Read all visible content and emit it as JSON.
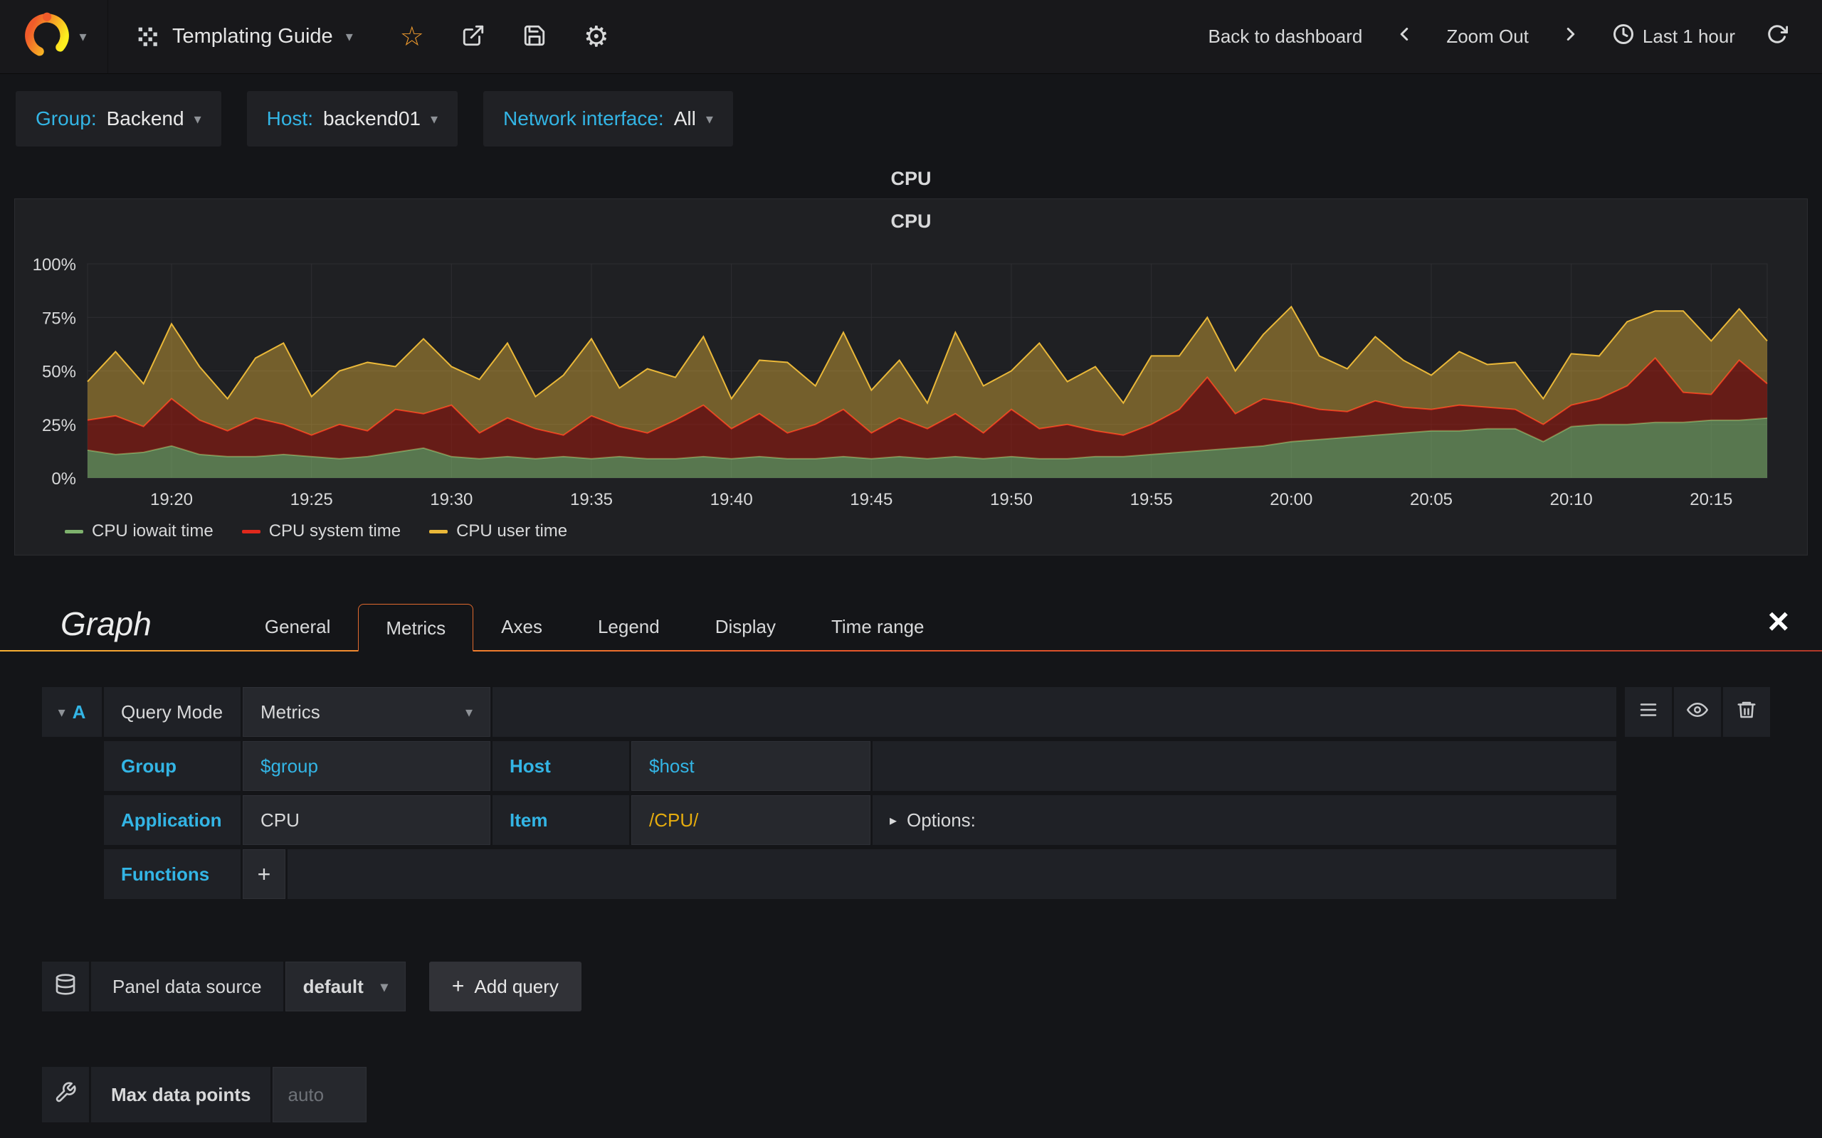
{
  "navbar": {
    "dashboard_title": "Templating Guide",
    "back_label": "Back to dashboard",
    "zoom_out_label": "Zoom Out",
    "time_label": "Last 1 hour"
  },
  "variables": [
    {
      "label": "Group:",
      "value": "Backend"
    },
    {
      "label": "Host:",
      "value": "backend01"
    },
    {
      "label": "Network interface:",
      "value": "All"
    }
  ],
  "panel": {
    "header_title": "CPU",
    "chart_title": "CPU"
  },
  "chart_data": {
    "type": "area",
    "stacked": true,
    "title": "CPU",
    "ylabel": "",
    "xlabel": "",
    "ylim": [
      0,
      100
    ],
    "y_ticks": [
      "0%",
      "25%",
      "50%",
      "75%",
      "100%"
    ],
    "x_ticks": [
      "19:20",
      "19:25",
      "19:30",
      "19:35",
      "19:40",
      "19:45",
      "19:50",
      "19:55",
      "20:00",
      "20:05",
      "20:10",
      "20:15"
    ],
    "x_tick_minutes": [
      3,
      8,
      13,
      18,
      23,
      28,
      33,
      38,
      43,
      48,
      53,
      58
    ],
    "x_range_minutes": [
      0,
      60
    ],
    "grid": true,
    "legend_position": "bottom-left",
    "series": [
      {
        "name": "CPU iowait time",
        "color": "#7eb26d",
        "fill": "rgba(126,178,109,0.6)",
        "values": [
          13,
          11,
          12,
          15,
          11,
          10,
          10,
          11,
          10,
          9,
          10,
          12,
          14,
          10,
          9,
          10,
          9,
          10,
          9,
          10,
          9,
          9,
          10,
          9,
          10,
          9,
          9,
          10,
          9,
          10,
          9,
          10,
          9,
          10,
          9,
          9,
          10,
          10,
          11,
          12,
          13,
          14,
          15,
          17,
          18,
          19,
          20,
          21,
          22,
          22,
          23,
          23,
          17,
          24,
          25,
          25,
          26,
          26,
          27,
          27,
          28
        ]
      },
      {
        "name": "CPU system time",
        "color": "#e0291c",
        "fill": "rgba(160,25,15,0.55)",
        "values": [
          14,
          18,
          12,
          22,
          16,
          12,
          18,
          14,
          10,
          16,
          12,
          20,
          16,
          24,
          12,
          18,
          14,
          10,
          20,
          14,
          12,
          18,
          24,
          14,
          20,
          12,
          16,
          22,
          12,
          18,
          14,
          20,
          12,
          22,
          14,
          16,
          12,
          10,
          14,
          20,
          34,
          16,
          22,
          18,
          14,
          12,
          16,
          12,
          10,
          12,
          10,
          9,
          8,
          10,
          12,
          18,
          30,
          14,
          12,
          28,
          16
        ]
      },
      {
        "name": "CPU user time",
        "color": "#eab839",
        "fill": "rgba(234,184,57,0.42)",
        "values": [
          18,
          30,
          20,
          35,
          25,
          15,
          28,
          38,
          18,
          25,
          32,
          20,
          35,
          18,
          25,
          35,
          15,
          28,
          36,
          18,
          30,
          20,
          32,
          14,
          25,
          33,
          18,
          36,
          20,
          27,
          12,
          38,
          22,
          18,
          40,
          20,
          30,
          15,
          32,
          25,
          28,
          20,
          30,
          45,
          25,
          20,
          30,
          22,
          16,
          25,
          20,
          22,
          12,
          24,
          20,
          30,
          22,
          38,
          25,
          24,
          20
        ]
      }
    ]
  },
  "editor": {
    "panel_type": "Graph",
    "tabs": [
      {
        "label": "General"
      },
      {
        "label": "Metrics"
      },
      {
        "label": "Axes"
      },
      {
        "label": "Legend"
      },
      {
        "label": "Display"
      },
      {
        "label": "Time range"
      }
    ],
    "active_tab": "Metrics",
    "query": {
      "ref": "A",
      "mode_label": "Query Mode",
      "mode_value": "Metrics",
      "group_label": "Group",
      "group_value": "$group",
      "host_label": "Host",
      "host_value": "$host",
      "application_label": "Application",
      "application_value": "CPU",
      "item_label": "Item",
      "item_value": "/CPU/",
      "options_label": "Options:",
      "functions_label": "Functions",
      "add_function_label": "+"
    },
    "datasource": {
      "label": "Panel data source",
      "value": "default",
      "add_query_label": "Add query"
    },
    "max_data_points": {
      "label": "Max data points",
      "placeholder": "auto"
    }
  }
}
